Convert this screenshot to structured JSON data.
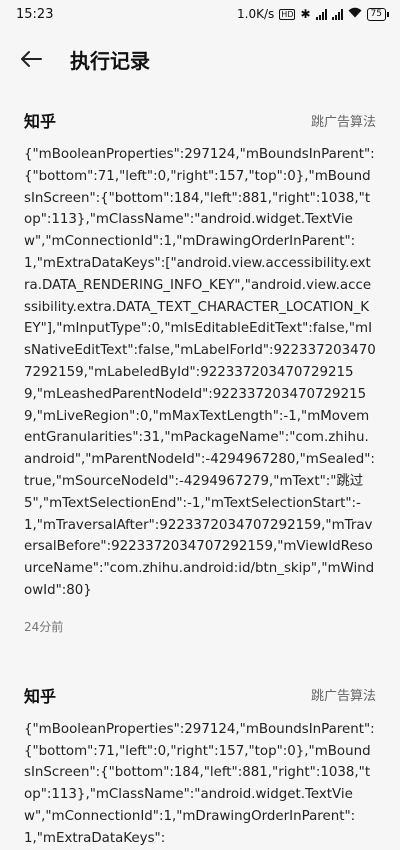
{
  "status_bar": {
    "time": "15:23",
    "net_speed": "1.0K/s",
    "battery": "75"
  },
  "header": {
    "title": "执行记录"
  },
  "records": [
    {
      "app_name": "知乎",
      "rule_name": "跳广告算法",
      "content": "{\"mBooleanProperties\":297124,\"mBoundsInParent\":{\"bottom\":71,\"left\":0,\"right\":157,\"top\":0},\"mBoundsInScreen\":{\"bottom\":184,\"left\":881,\"right\":1038,\"top\":113},\"mClassName\":\"android.widget.TextView\",\"mConnectionId\":1,\"mDrawingOrderInParent\":1,\"mExtraDataKeys\":[\"android.view.accessibility.extra.DATA_RENDERING_INFO_KEY\",\"android.view.accessibility.extra.DATA_TEXT_CHARACTER_LOCATION_KEY\"],\"mInputType\":0,\"mIsEditableEditText\":false,\"mIsNativeEditText\":false,\"mLabelForId\":9223372034707292159,\"mLabeledById\":9223372034707292159,\"mLeashedParentNodeId\":9223372034707292159,\"mLiveRegion\":0,\"mMaxTextLength\":-1,\"mMovementGranularities\":31,\"mPackageName\":\"com.zhihu.android\",\"mParentNodeId\":-4294967280,\"mSealed\":true,\"mSourceNodeId\":-4294967279,\"mText\":\"跳过 5\",\"mTextSelectionEnd\":-1,\"mTextSelectionStart\":-1,\"mTraversalAfter\":9223372034707292159,\"mTraversalBefore\":9223372034707292159,\"mViewIdResourceName\":\"com.zhihu.android:id/btn_skip\",\"mWindowId\":80}",
      "time": "24分前"
    },
    {
      "app_name": "知乎",
      "rule_name": "跳广告算法",
      "content": "{\"mBooleanProperties\":297124,\"mBoundsInParent\":{\"bottom\":71,\"left\":0,\"right\":157,\"top\":0},\"mBoundsInScreen\":{\"bottom\":184,\"left\":881,\"right\":1038,\"top\":113},\"mClassName\":\"android.widget.TextView\",\"mConnectionId\":1,\"mDrawingOrderInParent\":1,\"mExtraDataKeys\":",
      "time": ""
    }
  ]
}
